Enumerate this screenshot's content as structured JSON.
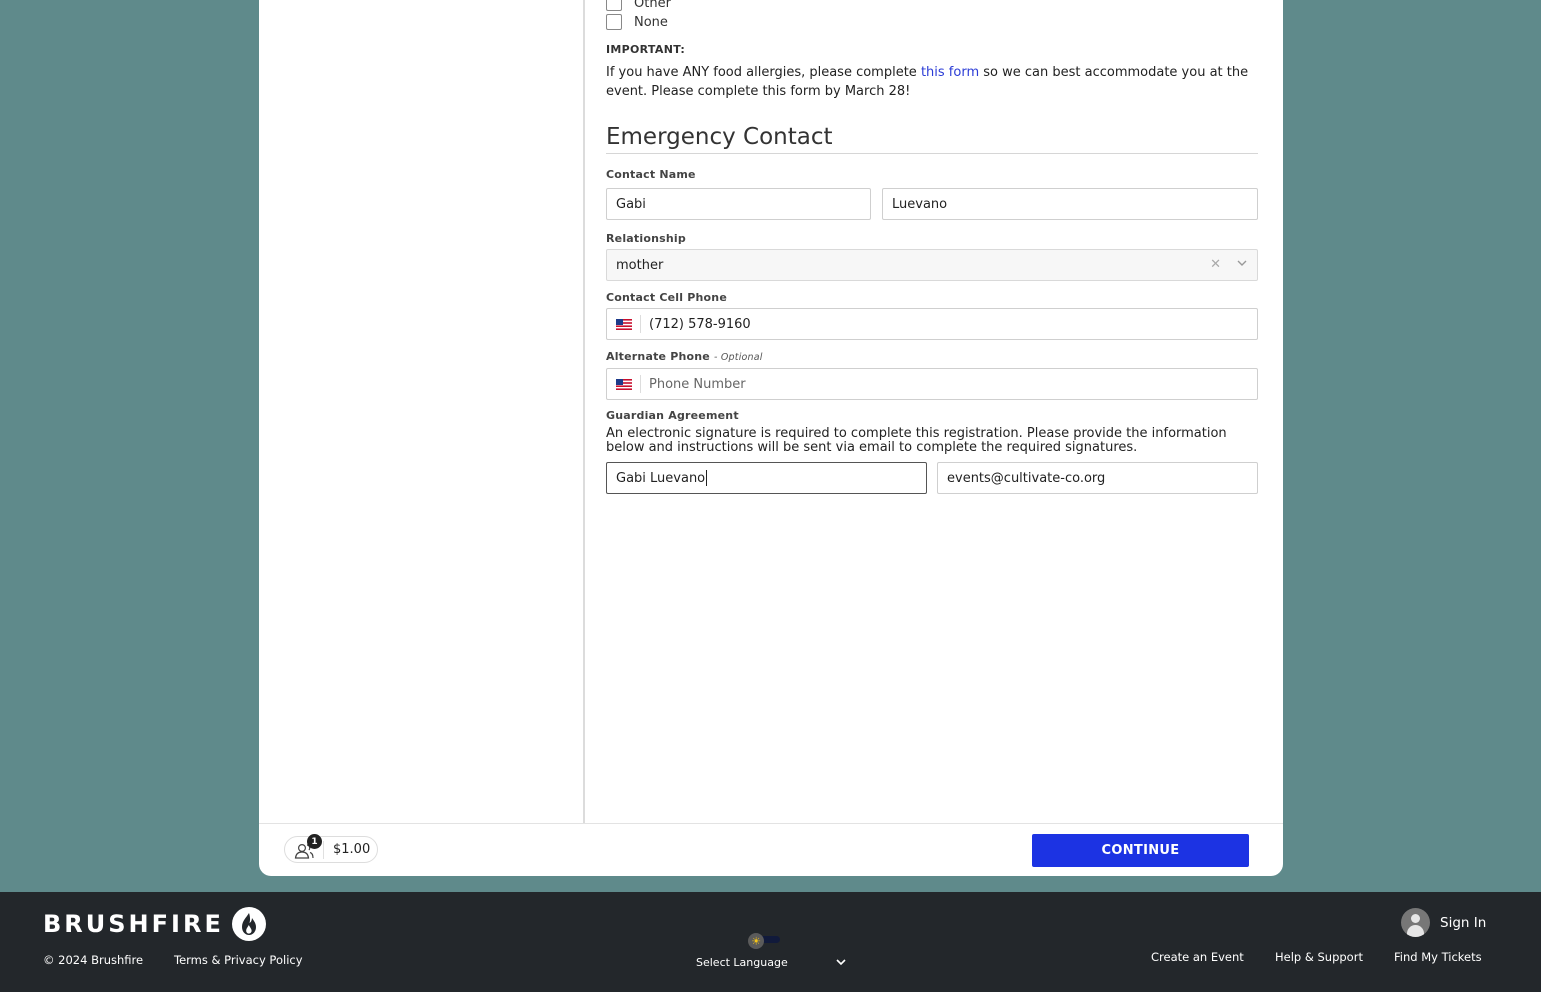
{
  "dietary": {
    "options": [
      {
        "label": "Other",
        "checked": false
      },
      {
        "label": "None",
        "checked": false
      }
    ],
    "important_label": "IMPORTANT:",
    "important_text_before": "If you have ANY food allergies, please complete ",
    "important_link": "this form",
    "important_text_after": " so we can best accommodate you at the event. Please complete this form by March 28!"
  },
  "emergency": {
    "title": "Emergency Contact",
    "contact_name_label": "Contact Name",
    "first_name": "Gabi",
    "last_name": "Luevano",
    "relationship_label": "Relationship",
    "relationship_value": "mother",
    "cell_label": "Contact Cell Phone",
    "cell_value": "(712) 578-9160",
    "alt_label": "Alternate Phone",
    "alt_optional": "- Optional",
    "alt_placeholder": "Phone Number",
    "guardian_label": "Guardian Agreement",
    "guardian_text": "An electronic signature is required to complete this registration. Please provide the information below and instructions will be sent via email to complete the required signatures.",
    "guardian_name": "Gabi Luevano",
    "guardian_email": "events@cultivate-co.org"
  },
  "bottom_bar": {
    "cart_count": "1",
    "cart_total": "$1.00",
    "continue_label": "CONTINUE",
    "accent_color": "#1c33e3"
  },
  "footer": {
    "logo_text": "BRUSHFIRE",
    "copyright": "© 2024 Brushfire",
    "terms": "Terms & Privacy Policy",
    "language_label": "Select Language",
    "sign_in": "Sign In",
    "links": [
      "Create an Event",
      "Help & Support",
      "Find My Tickets"
    ]
  }
}
